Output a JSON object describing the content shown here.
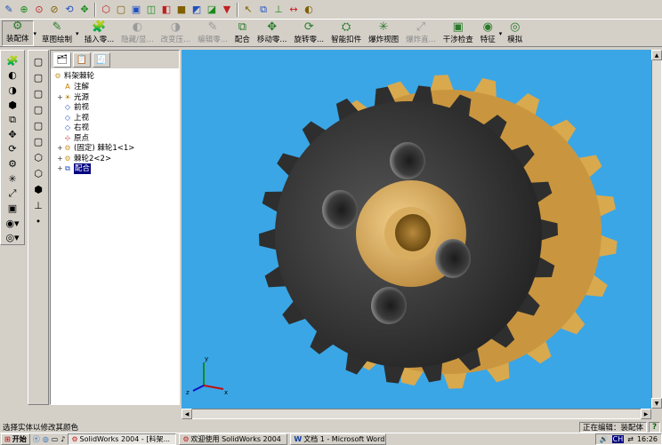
{
  "toolbar_top": {
    "icons": [
      "sketch-icon",
      "zoom-fit-icon",
      "zoom-area-icon",
      "zoom-inout-icon",
      "rotate-icon",
      "pan-icon",
      "view-orient-icon",
      "wireframe-icon",
      "hidden-lines-icon",
      "hidden-removed-icon",
      "shaded-edges-icon",
      "shaded-icon",
      "perspective-icon",
      "section-icon",
      "filter-icon",
      "select-icon",
      "mate-icon",
      "relation-icon",
      "smart-dim-icon",
      "appearance-icon"
    ]
  },
  "command_manager": {
    "buttons": [
      {
        "label": "装配体",
        "icon": "assembly-icon",
        "active": true,
        "disabled": false
      },
      {
        "label": "草图绘制",
        "icon": "sketch-icon",
        "active": false,
        "disabled": false
      },
      {
        "label": "插入零...",
        "icon": "insert-component-icon",
        "active": false,
        "disabled": false
      },
      {
        "label": "隐藏/显...",
        "icon": "hide-show-icon",
        "active": false,
        "disabled": true
      },
      {
        "label": "改变压...",
        "icon": "change-suppress-icon",
        "active": false,
        "disabled": true
      },
      {
        "label": "编辑零...",
        "icon": "edit-component-icon",
        "active": false,
        "disabled": true
      },
      {
        "label": "配合",
        "icon": "mate-icon",
        "active": false,
        "disabled": false
      },
      {
        "label": "移动零...",
        "icon": "move-component-icon",
        "active": false,
        "disabled": false
      },
      {
        "label": "旋转零...",
        "icon": "rotate-component-icon",
        "active": false,
        "disabled": false
      },
      {
        "label": "智能扣件",
        "icon": "smart-fastener-icon",
        "active": false,
        "disabled": false
      },
      {
        "label": "爆炸视图",
        "icon": "exploded-view-icon",
        "active": false,
        "disabled": false
      },
      {
        "label": "爆炸直...",
        "icon": "explode-line-icon",
        "active": false,
        "disabled": true
      },
      {
        "label": "干涉检查",
        "icon": "interference-icon",
        "active": false,
        "disabled": false
      },
      {
        "label": "特征",
        "icon": "feature-icon",
        "active": false,
        "disabled": false
      },
      {
        "label": "模拟",
        "icon": "simulation-icon",
        "active": false,
        "disabled": false
      }
    ]
  },
  "feature_tree": {
    "root": "料架棘轮",
    "items": [
      {
        "label": "注解",
        "icon": "annotation-icon",
        "expand": ""
      },
      {
        "label": "光源",
        "icon": "lighting-icon",
        "expand": "+"
      },
      {
        "label": "前视",
        "icon": "plane-icon",
        "expand": ""
      },
      {
        "label": "上视",
        "icon": "plane-icon",
        "expand": ""
      },
      {
        "label": "右视",
        "icon": "plane-icon",
        "expand": ""
      },
      {
        "label": "原点",
        "icon": "origin-icon",
        "expand": ""
      },
      {
        "label": "(固定) 棘轮1<1>",
        "icon": "part-icon",
        "expand": "+"
      },
      {
        "label": "棘轮2<2>",
        "icon": "part-icon",
        "expand": "+"
      },
      {
        "label": "配合",
        "icon": "mate-folder-icon",
        "expand": "+"
      }
    ]
  },
  "status_bar": {
    "message": "选择实体以修改其颜色",
    "editing": "正在编辑：装配体",
    "help": "?"
  },
  "taskbar": {
    "start": "开始",
    "tasks": [
      {
        "label": "SolidWorks 2004 - [料架...",
        "active": true
      },
      {
        "label": "欢迎使用 SolidWorks 2004",
        "active": false
      },
      {
        "label": "文档 1 - Microsoft Word",
        "active": false
      }
    ],
    "lang": "CH",
    "clock": "16:26"
  },
  "colors": {
    "viewport_bg": "#3aa6e6",
    "gear_dark": "#3a3a3a",
    "gear_gold": "#d9a94e",
    "hub_gold": "#d8ab5a"
  }
}
